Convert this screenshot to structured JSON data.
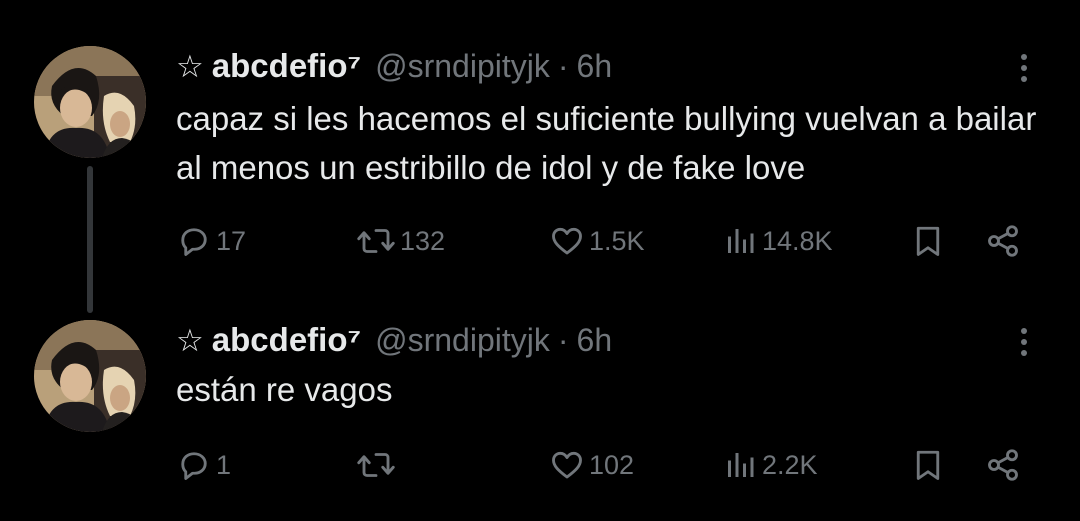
{
  "colors": {
    "background": "#000000",
    "text_primary": "#e7e9ea",
    "text_secondary": "#71767b",
    "thread_line": "#333639"
  },
  "tweets": [
    {
      "display_name": "abcdefio⁷",
      "handle": "@srndipityjk",
      "separator": "·",
      "time": "6h",
      "text": "capaz si les hacemos el suficiente bullying vuelvan a bailar al menos un estribillo de idol y de fake love",
      "replies": "17",
      "reposts": "132",
      "likes": "1.5K",
      "views": "14.8K"
    },
    {
      "display_name": "abcdefio⁷",
      "handle": "@srndipityjk",
      "separator": "·",
      "time": "6h",
      "text": "están re vagos",
      "replies": "1",
      "reposts": "",
      "likes": "102",
      "views": "2.2K"
    }
  ],
  "icons": {
    "star": "☆",
    "reply": "reply-icon",
    "repost": "repost-icon",
    "like": "heart-icon",
    "views": "views-icon",
    "bookmark": "bookmark-icon",
    "share": "share-icon",
    "more": "more-icon"
  }
}
